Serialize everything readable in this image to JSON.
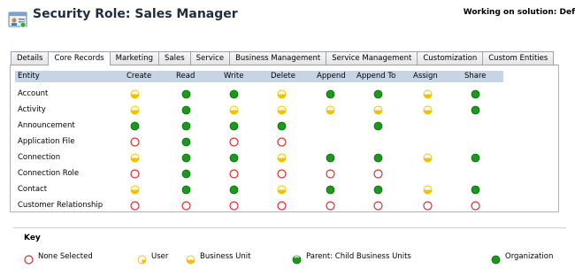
{
  "header": {
    "title": "Security Role: Sales Manager",
    "solution_text": "Working on solution: Def",
    "icon": "security-role-icon"
  },
  "tabs": [
    {
      "label": "Details",
      "active": false
    },
    {
      "label": "Core Records",
      "active": true
    },
    {
      "label": "Marketing",
      "active": false
    },
    {
      "label": "Sales",
      "active": false
    },
    {
      "label": "Service",
      "active": false
    },
    {
      "label": "Business Management",
      "active": false
    },
    {
      "label": "Service Management",
      "active": false
    },
    {
      "label": "Customization",
      "active": false
    },
    {
      "label": "Custom Entities",
      "active": false
    }
  ],
  "grid": {
    "columns": [
      "Entity",
      "Create",
      "Read",
      "Write",
      "Delete",
      "Append",
      "Append To",
      "Assign",
      "Share"
    ],
    "rows": [
      {
        "entity": "Account",
        "levels": [
          "business_unit",
          "organization",
          "organization",
          "business_unit",
          "organization",
          "organization",
          "business_unit",
          "organization"
        ]
      },
      {
        "entity": "Activity",
        "levels": [
          "business_unit",
          "organization",
          "business_unit",
          "business_unit",
          "business_unit",
          "business_unit",
          "business_unit",
          "organization"
        ]
      },
      {
        "entity": "Announcement",
        "levels": [
          "organization",
          "organization",
          "organization",
          "organization",
          "",
          "organization",
          "",
          ""
        ]
      },
      {
        "entity": "Application File",
        "levels": [
          "none",
          "organization",
          "none",
          "none",
          "",
          "",
          "",
          ""
        ]
      },
      {
        "entity": "Connection",
        "levels": [
          "business_unit",
          "organization",
          "organization",
          "business_unit",
          "organization",
          "organization",
          "business_unit",
          "organization"
        ]
      },
      {
        "entity": "Connection Role",
        "levels": [
          "none",
          "organization",
          "none",
          "none",
          "none",
          "none",
          "",
          ""
        ]
      },
      {
        "entity": "Contact",
        "levels": [
          "business_unit",
          "organization",
          "organization",
          "business_unit",
          "organization",
          "organization",
          "business_unit",
          "organization"
        ]
      },
      {
        "entity": "Customer Relationship",
        "levels": [
          "none",
          "none",
          "none",
          "none",
          "none",
          "none",
          "none",
          "none"
        ]
      }
    ]
  },
  "key": {
    "title": "Key",
    "items": [
      {
        "level": "none",
        "label": "None Selected"
      },
      {
        "level": "user",
        "label": "User"
      },
      {
        "level": "business_unit",
        "label": "Business Unit"
      },
      {
        "level": "parent_child",
        "label": "Parent: Child Business Units"
      },
      {
        "level": "organization",
        "label": "Organization"
      }
    ]
  },
  "colors": {
    "organization": "#1a9a1a",
    "business_unit": "#f2c200",
    "none": "#d83030",
    "header_bg": "#c6d4e4"
  }
}
